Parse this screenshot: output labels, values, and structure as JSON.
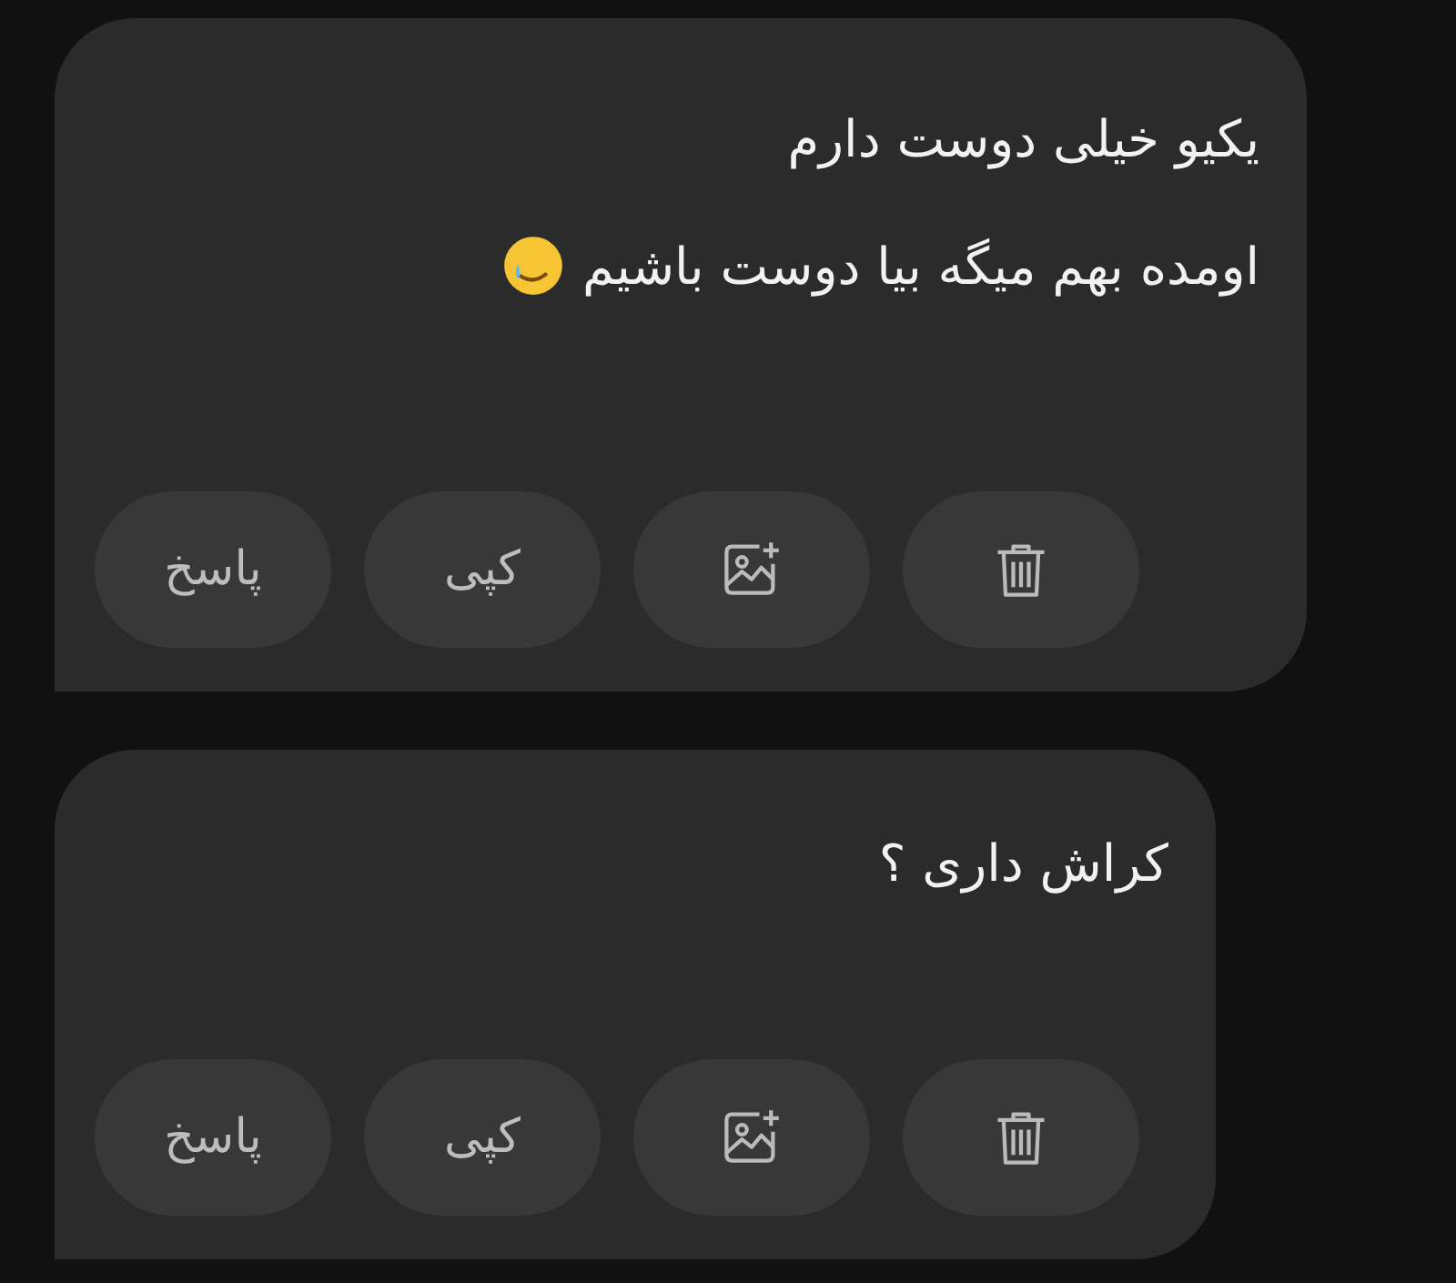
{
  "messages": [
    {
      "lines": [
        "یکیو خیلی دوست دارم",
        "اومده بهم میگه بیا دوست باشیم"
      ],
      "emoji_after_last_line": true,
      "actions": [
        {
          "kind": "delete"
        },
        {
          "kind": "image"
        },
        {
          "kind": "text",
          "label": "کپی"
        },
        {
          "kind": "text",
          "label": "پاسخ"
        }
      ]
    },
    {
      "lines": [
        "کراش داری ؟"
      ],
      "emoji_after_last_line": false,
      "actions": [
        {
          "kind": "delete"
        },
        {
          "kind": "image"
        },
        {
          "kind": "text",
          "label": "کپی"
        },
        {
          "kind": "text",
          "label": "پاسخ"
        }
      ]
    }
  ]
}
